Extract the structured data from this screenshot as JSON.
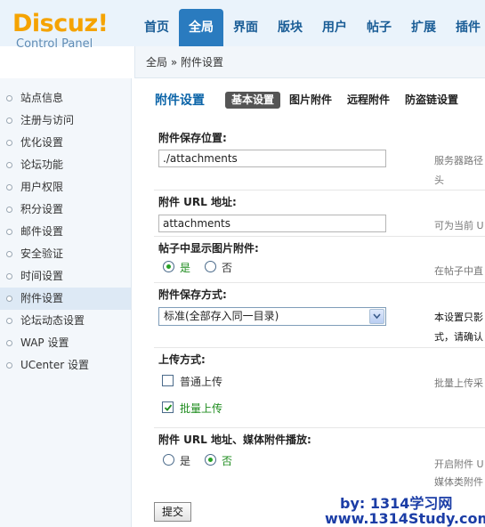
{
  "logo": {
    "brand": "Discuz!",
    "subtitle": "Control Panel"
  },
  "nav": {
    "items": [
      "首页",
      "全局",
      "界面",
      "版块",
      "用户",
      "帖子",
      "扩展",
      "插件"
    ],
    "active": 1
  },
  "breadcrumb": "全局 » 附件设置",
  "sidebar": {
    "items": [
      "站点信息",
      "注册与访问",
      "优化设置",
      "论坛功能",
      "用户权限",
      "积分设置",
      "邮件设置",
      "安全验证",
      "时间设置",
      "附件设置",
      "论坛动态设置",
      "WAP 设置",
      "UCenter 设置"
    ],
    "active": 9
  },
  "page": {
    "title": "附件设置",
    "tabs": [
      "基本设置",
      "图片附件",
      "远程附件",
      "防盗链设置"
    ],
    "active_tab": 0
  },
  "form": {
    "save_path": {
      "label": "附件保存位置:",
      "value": "./attachments",
      "hint_line1": "服务器路径",
      "hint_line2": "头"
    },
    "url": {
      "label": "附件 URL 地址:",
      "value": "attachments",
      "hint": "可为当前 U"
    },
    "show_images": {
      "label": "帖子中显示图片附件:",
      "yes": "是",
      "no": "否",
      "selected": "yes",
      "hint": "在帖子中直"
    },
    "save_mode": {
      "label": "附件保存方式:",
      "value": "标准(全部存入同一目录)",
      "hint_line1": "本设置只影",
      "hint_line2": "式，请确认"
    },
    "upload_mode": {
      "label": "上传方式:",
      "normal": "普通上传",
      "batch": "批量上传",
      "normal_checked": false,
      "batch_checked": true,
      "hint": "批量上传采"
    },
    "media_play": {
      "label": "附件 URL 地址、媒体附件播放:",
      "yes": "是",
      "no": "否",
      "selected": "no",
      "hint_line1": "开启附件 U",
      "hint_line2": "媒体类附件"
    }
  },
  "submit_label": "提交",
  "watermark": {
    "line1": "by: 1314学习网",
    "line2": "www.1314Study.com"
  }
}
